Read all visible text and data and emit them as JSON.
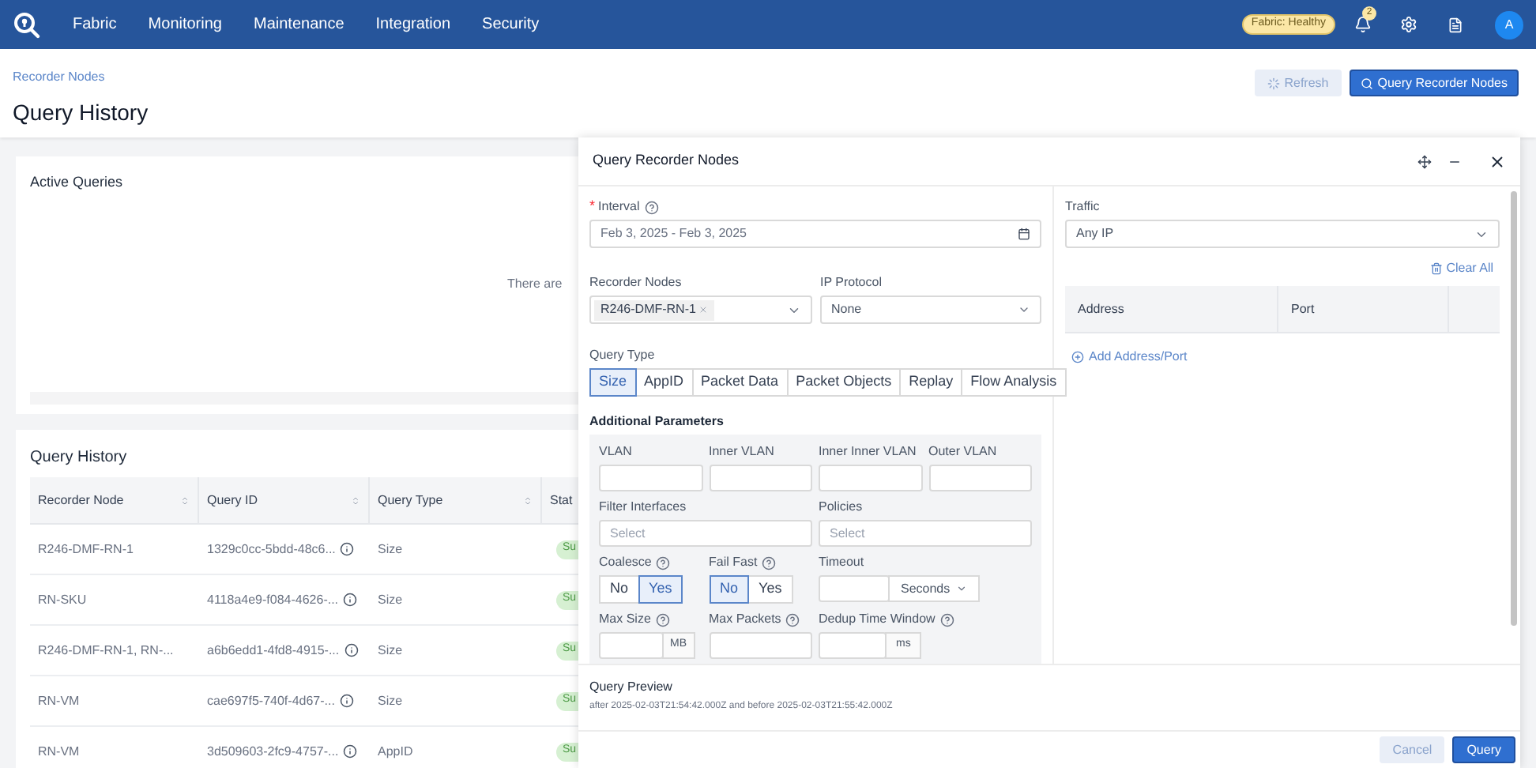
{
  "nav": {
    "items": [
      "Fabric",
      "Monitoring",
      "Maintenance",
      "Integration",
      "Security"
    ],
    "fabric_status": "Fabric: Healthy",
    "notifications_count": "2",
    "avatar": "A"
  },
  "page": {
    "breadcrumb": "Recorder Nodes",
    "title": "Query History",
    "buttons": [
      {
        "label": "Refresh",
        "kind": "loading"
      },
      {
        "label": "Query Recorder Nodes",
        "kind": "primary"
      }
    ]
  },
  "active_queries": {
    "title": "Active Queries",
    "empty_text": "There are"
  },
  "query_history": {
    "title": "Query History",
    "columns": [
      "Recorder Node",
      "Query ID",
      "Query Type",
      "Stat"
    ],
    "rows": [
      {
        "recorder_node": "R246-DMF-RN-1",
        "query_id": "1329c0cc-5bdd-48c6...",
        "query_type": "Size",
        "status": "Su"
      },
      {
        "recorder_node": "RN-SKU",
        "query_id": "4118a4e9-f084-4626-...",
        "query_type": "Size",
        "status": "Su"
      },
      {
        "recorder_node": "R246-DMF-RN-1, RN-...",
        "query_id": "a6b6edd1-4fd8-4915-...",
        "query_type": "Size",
        "status": "Su"
      },
      {
        "recorder_node": "RN-VM",
        "query_id": "cae697f5-740f-4d67-...",
        "query_type": "Size",
        "status": "Su"
      },
      {
        "recorder_node": "RN-VM",
        "query_id": "3d509603-2fc9-4757-...",
        "query_type": "AppID",
        "status": "Su"
      }
    ]
  },
  "dialog": {
    "title": "Query Recorder Nodes",
    "interval": {
      "label": "Interval",
      "required_mark": "*",
      "help": true,
      "value": "Feb 3, 2025 - Feb 3, 2025"
    },
    "recorder_nodes": {
      "label": "Recorder Nodes",
      "tags": [
        "R246-DMF-RN-1"
      ]
    },
    "ip_protocol": {
      "label": "IP Protocol",
      "value": "None"
    },
    "query_type": {
      "label": "Query Type",
      "options": [
        {
          "label": "Size",
          "selected": true
        },
        {
          "label": "AppID",
          "selected": false
        },
        {
          "label": "Packet Data",
          "selected": false
        },
        {
          "label": "Packet Objects",
          "selected": false
        },
        {
          "label": "Replay",
          "selected": false
        },
        {
          "label": "Flow Analysis",
          "selected": false
        }
      ]
    },
    "additional_parameters": {
      "title": "Additional Parameters",
      "vlan_fields": [
        "VLAN",
        "Inner VLAN",
        "Inner Inner VLAN",
        "Outer VLAN"
      ],
      "filter_interfaces": {
        "label": "Filter Interfaces",
        "placeholder": "Select"
      },
      "policies": {
        "label": "Policies",
        "placeholder": "Select"
      },
      "coalesce": {
        "label": "Coalesce",
        "help": true,
        "options": [
          {
            "label": "No",
            "selected": false
          },
          {
            "label": "Yes",
            "selected": true
          }
        ]
      },
      "fail_fast": {
        "label": "Fail Fast",
        "help": true,
        "options": [
          {
            "label": "No",
            "selected": true
          },
          {
            "label": "Yes",
            "selected": false
          }
        ]
      },
      "timeout": {
        "label": "Timeout",
        "unit": "Seconds"
      },
      "max_size": {
        "label": "Max Size",
        "help": true,
        "unit": "MB"
      },
      "max_packets": {
        "label": "Max Packets",
        "help": true
      },
      "dedup_time_window": {
        "label": "Dedup Time Window",
        "help": true,
        "unit": "ms"
      }
    },
    "traffic": {
      "label": "Traffic",
      "value": "Any IP",
      "clear_label": "Clear All",
      "columns": [
        "Address",
        "Port"
      ],
      "add_label": "Add Address/Port"
    },
    "preview": {
      "title": "Query Preview",
      "text": "after 2025-02-03T21:54:42.000Z and before 2025-02-03T21:55:42.000Z"
    },
    "buttons": [
      {
        "label": "Cancel",
        "kind": "secondary"
      },
      {
        "label": "Query",
        "kind": "primary"
      }
    ]
  }
}
